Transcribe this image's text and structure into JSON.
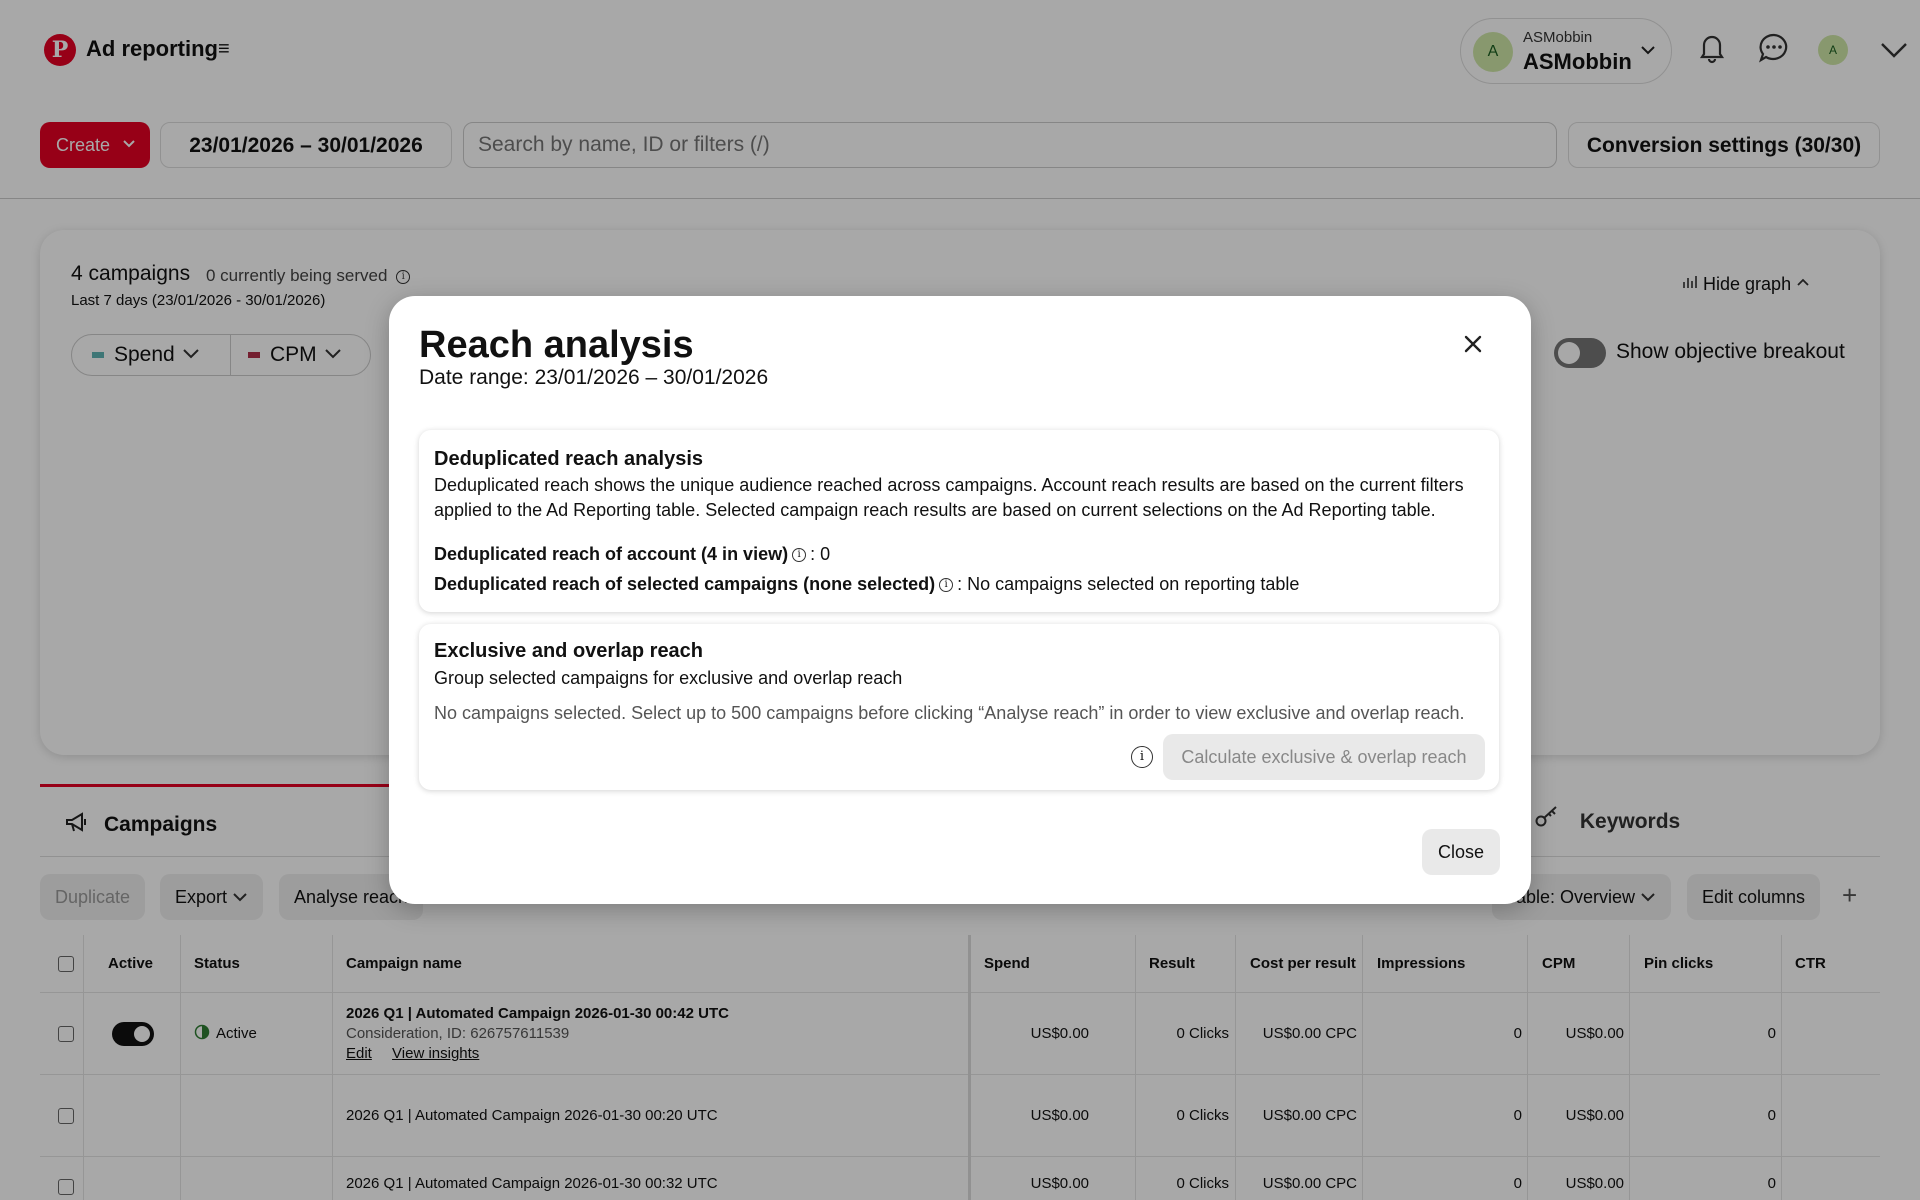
{
  "header": {
    "logo_letter": "P",
    "title": "Ad reporting",
    "account": {
      "avatar_letter": "A",
      "small_name": "ASMobbin",
      "big_name": "ASMobbin"
    },
    "profile_avatar_letter": "A"
  },
  "toolbar": {
    "create_label": "Create",
    "date_range": "23/01/2026 – 30/01/2026",
    "search_placeholder": "Search by name, ID or filters (/)",
    "conversion_settings": "Conversion settings (30/30)"
  },
  "graph_card": {
    "campaign_count": "4 campaigns",
    "served_text": "0 currently being served",
    "last_days": "Last 7 days (23/01/2026 - 30/01/2026)",
    "hide_graph": "Hide graph",
    "metrics": [
      {
        "label": "Spend",
        "color": "#5fb3b3"
      },
      {
        "label": "CPM",
        "color": "#b0304a"
      }
    ],
    "objective_toggle_label": "Show objective breakout"
  },
  "tabs": {
    "campaigns": "Campaigns",
    "keywords": "Keywords"
  },
  "table_actions": {
    "duplicate": "Duplicate",
    "export": "Export",
    "analyse_reach": "Analyse reach",
    "table_view": "Table: Overview",
    "edit_columns": "Edit columns"
  },
  "table": {
    "headers": [
      "Active",
      "Status",
      "Campaign name",
      "Spend",
      "Result",
      "Cost per result",
      "Impressions",
      "CPM",
      "Pin clicks",
      "CTR"
    ],
    "rows": [
      {
        "status": "Active",
        "name": "2026 Q1 | Automated Campaign 2026-01-30 00:42 UTC",
        "sub": "Consideration, ID: 626757611539",
        "edit": "Edit",
        "view": "View insights",
        "spend": "US$0.00",
        "result": "0 Clicks",
        "cpr": "US$0.00 CPC",
        "impressions": "0",
        "cpm": "US$0.00",
        "pin_clicks": "0",
        "ctr": ""
      },
      {
        "status": "",
        "name": "2026 Q1 | Automated Campaign 2026-01-30 00:20 UTC",
        "spend": "US$0.00",
        "result": "0 Clicks",
        "cpr": "US$0.00 CPC",
        "impressions": "0",
        "cpm": "US$0.00",
        "pin_clicks": "0",
        "ctr": ""
      },
      {
        "status": "",
        "name": "2026 Q1 | Automated Campaign 2026-01-30 00:32 UTC",
        "spend": "US$0.00",
        "result": "0 Clicks",
        "cpr": "US$0.00 CPC",
        "impressions": "0",
        "cpm": "US$0.00",
        "pin_clicks": "0",
        "ctr": ""
      }
    ]
  },
  "modal": {
    "title": "Reach analysis",
    "date_range": "Date range: 23/01/2026 – 30/01/2026",
    "dedup": {
      "title": "Deduplicated reach analysis",
      "description": "Deduplicated reach shows the unique audience reached across campaigns. Account reach results are based on the current filters applied to the Ad Reporting table. Selected campaign reach results are based on current selections on the Ad Reporting table.",
      "account_label": "Deduplicated reach of account (4 in view)",
      "account_value": ": 0",
      "selected_label": "Deduplicated reach of selected campaigns (none selected)",
      "selected_value": ": No campaigns selected on reporting table"
    },
    "exclusive": {
      "title": "Exclusive and overlap reach",
      "subtitle": "Group selected campaigns for exclusive and overlap reach",
      "note": "No campaigns selected. Select up to 500 campaigns before clicking “Analyse reach” in order to view exclusive and overlap reach.",
      "calc_button": "Calculate exclusive & overlap reach"
    },
    "close_button": "Close"
  }
}
